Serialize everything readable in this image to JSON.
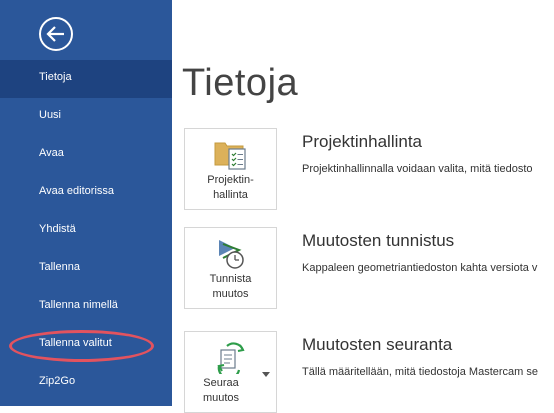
{
  "sidebar": {
    "back_icon": "back-arrow-icon",
    "items": [
      {
        "label": "Tietoja",
        "active": true
      },
      {
        "label": "Uusi"
      },
      {
        "label": "Avaa"
      },
      {
        "label": "Avaa editorissa"
      },
      {
        "label": "Yhdistä"
      },
      {
        "label": "Tallenna"
      },
      {
        "label": "Tallenna nimellä"
      },
      {
        "label": "Tallenna valitut",
        "highlighted": true
      },
      {
        "label": "Zip2Go"
      }
    ]
  },
  "main": {
    "title": "Tietoja",
    "cards": [
      {
        "tile_label_line1": "Projektin-",
        "tile_label_line2": "hallinta",
        "heading": "Projektinhallinta",
        "description": "Projektinhallinnalla voidaan valita, mitä tiedosto",
        "icon": "folder-checklist-icon"
      },
      {
        "tile_label_line1": "Tunnista",
        "tile_label_line2": "muutos",
        "heading": "Muutosten tunnistus",
        "description": "Kappaleen geometriantiedoston kahta versiota v",
        "icon": "change-detection-icon"
      },
      {
        "tile_label_line1": "Seuraa",
        "tile_label_line2": "muutos",
        "heading": "Muutosten seuranta",
        "description": "Tällä määritellään, mitä tiedostoja Mastercam se",
        "icon": "track-changes-icon"
      }
    ]
  },
  "colors": {
    "sidebar_bg": "#2b579a",
    "sidebar_active_bg": "#1e4380",
    "highlight_ring": "#e2535f"
  }
}
